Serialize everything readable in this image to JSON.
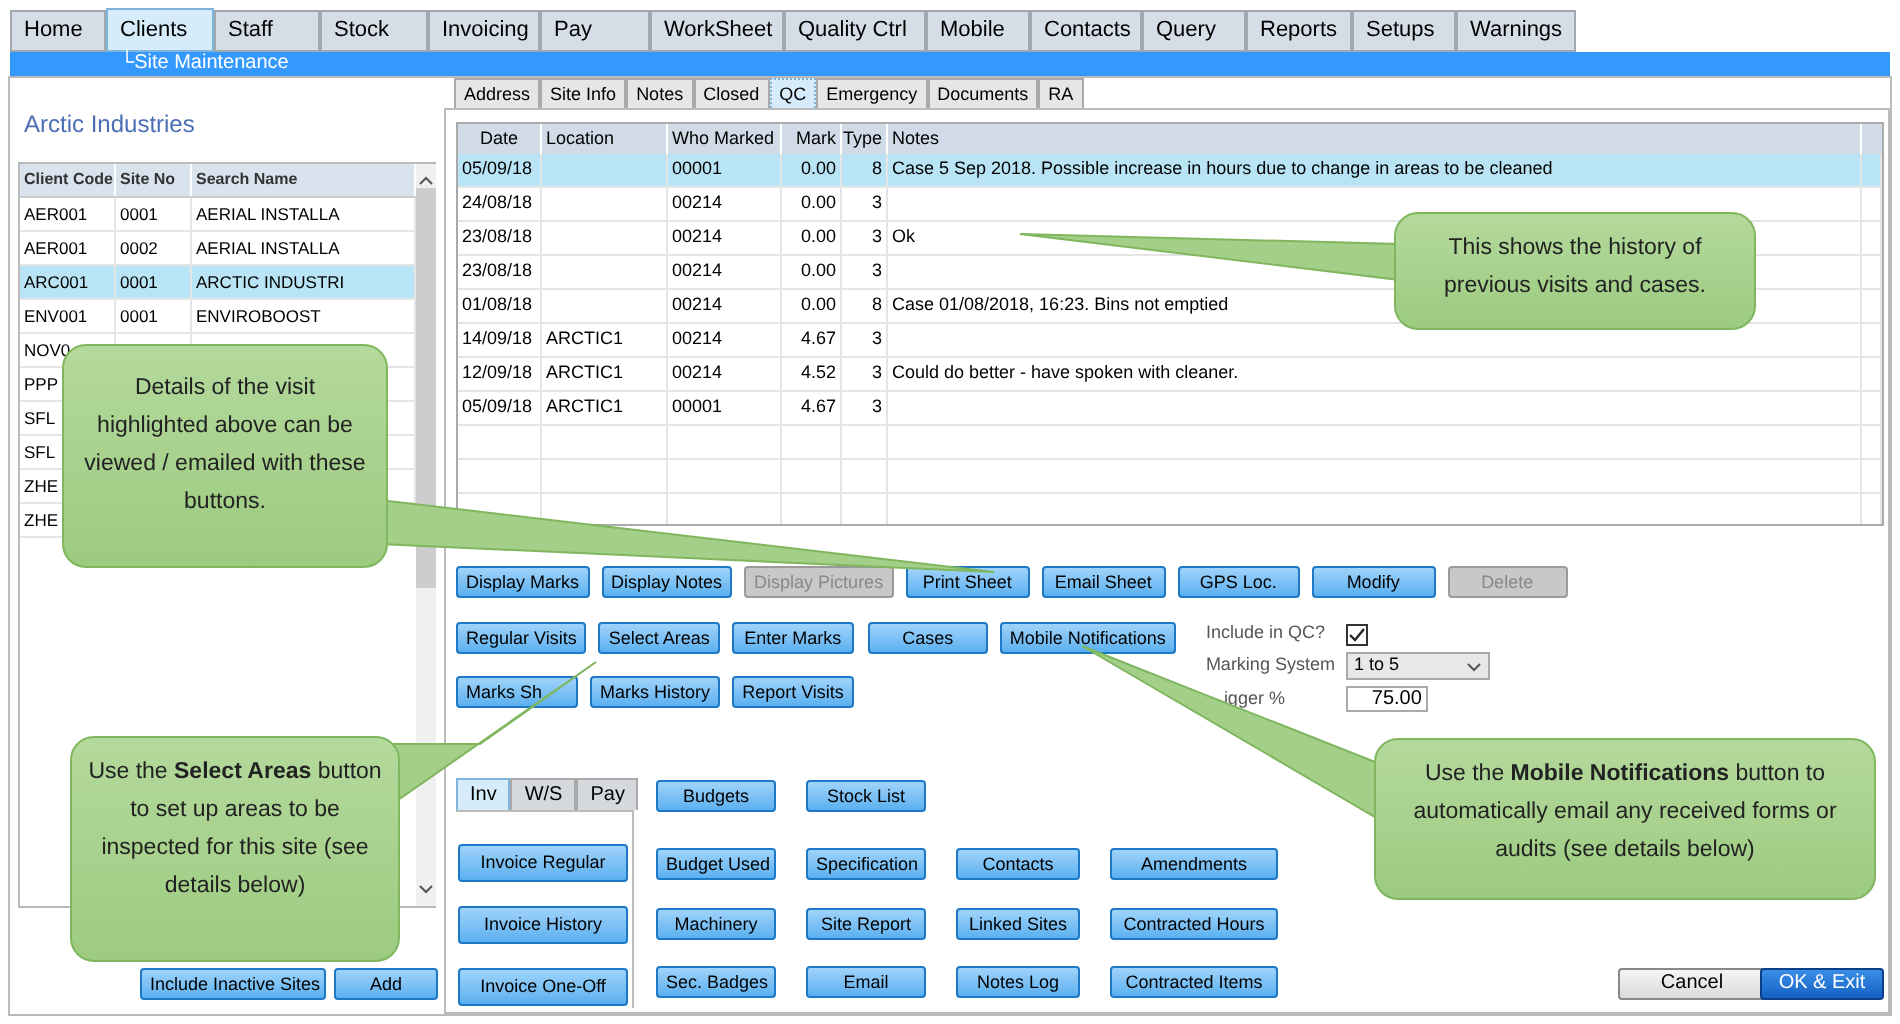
{
  "menu_tabs": [
    {
      "label": "Home",
      "selected": false
    },
    {
      "label": "Clients",
      "selected": true
    },
    {
      "label": "Staff",
      "selected": false
    },
    {
      "label": "Stock",
      "selected": false
    },
    {
      "label": "Invoicing",
      "selected": false
    },
    {
      "label": "Pay",
      "selected": false
    },
    {
      "label": "WorkSheet",
      "selected": false
    },
    {
      "label": "Quality Ctrl",
      "selected": false
    },
    {
      "label": "Mobile",
      "selected": false
    },
    {
      "label": "Contacts",
      "selected": false
    },
    {
      "label": "Query",
      "selected": false
    },
    {
      "label": "Reports",
      "selected": false
    },
    {
      "label": "Setups",
      "selected": false
    },
    {
      "label": "Warnings",
      "selected": false
    }
  ],
  "breadcrumb": "└Site Maintenance",
  "client_list": {
    "title": "Arctic Industries",
    "columns": [
      "Client Code",
      "Site No",
      "Search Name"
    ],
    "rows": [
      {
        "cells": [
          "AER001",
          "0001",
          "AERIAL INSTALLA"
        ],
        "selected": false
      },
      {
        "cells": [
          "AER001",
          "0002",
          "AERIAL INSTALLA"
        ],
        "selected": false
      },
      {
        "cells": [
          "ARC001",
          "0001",
          "ARCTIC INDUSTRI"
        ],
        "selected": true
      },
      {
        "cells": [
          "ENV001",
          "0001",
          "ENVIROBOOST"
        ],
        "selected": false
      },
      {
        "cells": [
          "NOV0"
        ],
        "selected": false
      },
      {
        "cells": [
          "PPP"
        ],
        "selected": false
      },
      {
        "cells": [
          "SFL"
        ],
        "selected": false
      },
      {
        "cells": [
          "SFL"
        ],
        "selected": false
      },
      {
        "cells": [
          "ZHE"
        ],
        "selected": false
      },
      {
        "cells": [
          "ZHE"
        ],
        "selected": false
      }
    ]
  },
  "list_buttons": [
    "Include Inactive Sites",
    "Add"
  ],
  "site_tabs": [
    {
      "label": "Address",
      "selected": false
    },
    {
      "label": "Site Info",
      "selected": false
    },
    {
      "label": "Notes",
      "selected": false
    },
    {
      "label": "Closed",
      "selected": false
    },
    {
      "label": "QC",
      "selected": true
    },
    {
      "label": "Emergency",
      "selected": false
    },
    {
      "label": "Documents",
      "selected": false
    },
    {
      "label": "RA",
      "selected": false
    }
  ],
  "qc_table": {
    "columns": [
      "Date",
      "Location",
      "Who Marked",
      "Mark",
      "Type",
      "Notes"
    ],
    "rows": [
      {
        "cells": [
          "05/09/18",
          "",
          "00001",
          "0.00",
          "8",
          "Case 5 Sep 2018. Possible increase in hours due to change in areas to be cleaned"
        ],
        "selected": true
      },
      {
        "cells": [
          "24/08/18",
          "",
          "00214",
          "0.00",
          "3",
          ""
        ],
        "selected": false
      },
      {
        "cells": [
          "23/08/18",
          "",
          "00214",
          "0.00",
          "3",
          "Ok"
        ],
        "selected": false
      },
      {
        "cells": [
          "23/08/18",
          "",
          "00214",
          "0.00",
          "3",
          ""
        ],
        "selected": false
      },
      {
        "cells": [
          "01/08/18",
          "",
          "00214",
          "0.00",
          "8",
          "Case 01/08/2018, 16:23. Bins not emptied"
        ],
        "selected": false
      },
      {
        "cells": [
          "14/09/18",
          "ARCTIC1",
          "00214",
          "4.67",
          "3",
          ""
        ],
        "selected": false
      },
      {
        "cells": [
          "12/09/18",
          "ARCTIC1",
          "00214",
          "4.52",
          "3",
          "Could do better - have spoken with cleaner."
        ],
        "selected": false
      },
      {
        "cells": [
          "05/09/18",
          "ARCTIC1",
          "00001",
          "4.67",
          "3",
          ""
        ],
        "selected": false
      }
    ]
  },
  "action_buttons": [
    [
      {
        "label": "Display Marks",
        "disabled": false
      },
      {
        "label": "Display Notes",
        "disabled": false
      },
      {
        "label": "Display Pictures",
        "disabled": true
      },
      {
        "label": "Print Sheet",
        "disabled": false
      },
      {
        "label": "Email Sheet",
        "disabled": false
      },
      {
        "label": "GPS Loc.",
        "disabled": false
      },
      {
        "label": "Modify",
        "disabled": false
      },
      {
        "label": "Delete",
        "disabled": true
      }
    ],
    [
      {
        "label": "Regular Visits",
        "disabled": false
      },
      {
        "label": "Select Areas",
        "disabled": false
      },
      {
        "label": "Enter Marks",
        "disabled": false
      },
      {
        "label": "Cases",
        "disabled": false
      },
      {
        "label": "Mobile Notifications",
        "disabled": false
      }
    ],
    [
      {
        "label": "Marks Sh",
        "disabled": false
      },
      {
        "label": "Marks History",
        "disabled": false
      },
      {
        "label": "Report Visits",
        "disabled": false
      }
    ]
  ],
  "qc_settings": {
    "include_in_qc": {
      "label": "Include in QC?",
      "checked": true
    },
    "marking_system": {
      "label": "Marking System",
      "value": "1 to 5"
    },
    "trigger": {
      "label": "igger %",
      "value": "75.00"
    }
  },
  "lower_tabs": [
    {
      "label": "Inv",
      "selected": true
    },
    {
      "label": "W/S",
      "selected": false
    },
    {
      "label": "Pay",
      "selected": false
    }
  ],
  "invoice_buttons": [
    "Invoice Regular",
    "Invoice History",
    "Invoice One-Off"
  ],
  "feature_buttons": [
    [
      "Budgets",
      "Budget Used",
      "Machinery",
      "Sec. Badges"
    ],
    [
      "Stock List",
      "Specification",
      "Site Report",
      "Email"
    ],
    [
      "Contacts",
      "Linked Sites",
      "Notes Log"
    ],
    [
      "Amendments",
      "Contracted Hours",
      "Contracted Items"
    ]
  ],
  "dialog_buttons": [
    {
      "label": "Cancel",
      "kind": "normal"
    },
    {
      "label": "OK & Exit",
      "kind": "primary"
    }
  ],
  "callouts": [
    {
      "text": "Details of the visit highlighted above can be viewed / emailed with these buttons."
    },
    {
      "text": "This shows the history of previous visits and cases."
    },
    {
      "text": "Use the **Select Areas** button to set up areas to be inspected for this site (see details below)"
    },
    {
      "text": "Use the **Mobile Notifications** button to automatically email any received forms or audits (see details below)"
    }
  ]
}
